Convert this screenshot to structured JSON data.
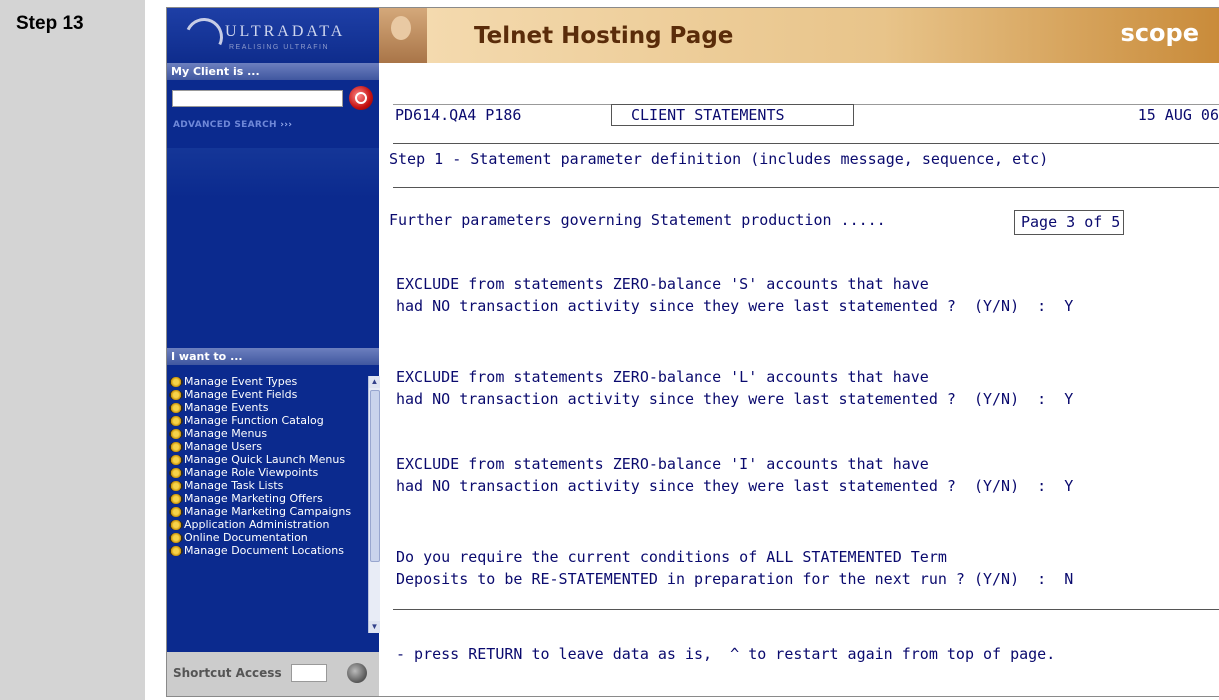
{
  "step_label": "Step 13",
  "sidebar": {
    "logo_text": "ULTRADATA",
    "logo_tagline": "REALISING ULTRAFIN",
    "client_section_title": "My Client is ...",
    "client_input_value": "",
    "advanced_search": "ADVANCED SEARCH",
    "iwant_section_title": "I want to ...",
    "menu_items": [
      "Manage Event Types",
      "Manage Event Fields",
      "Manage Events",
      "Manage Function Catalog",
      "Manage Menus",
      "Manage Users",
      "Manage Quick Launch Menus",
      "Manage Role Viewpoints",
      "Manage Task Lists",
      "Manage Marketing Offers",
      "Manage Marketing Campaigns",
      "Application Administration",
      "Online Documentation",
      "Manage Document Locations"
    ],
    "shortcut_label": "Shortcut Access",
    "shortcut_value": ""
  },
  "header": {
    "title": "Telnet Hosting Page",
    "brand": "scope"
  },
  "terminal": {
    "program_id": "PD614.QA4 P186",
    "screen_title": "CLIENT STATEMENTS",
    "date": "15 AUG 06",
    "step_line": "Step 1 - Statement parameter definition (includes message, sequence, etc)",
    "further_line": "Further parameters governing Statement production .....",
    "page_indicator": "Page 3 of 5",
    "q1_line1": "EXCLUDE from statements ZERO-balance 'S' accounts that have",
    "q1_line2": "had NO transaction activity since they were last statemented ?  (Y/N)  :  Y",
    "q2_line1": "EXCLUDE from statements ZERO-balance 'L' accounts that have",
    "q2_line2": "had NO transaction activity since they were last statemented ?  (Y/N)  :  Y",
    "q3_line1": "EXCLUDE from statements ZERO-balance 'I' accounts that have",
    "q3_line2": "had NO transaction activity since they were last statemented ?  (Y/N)  :  Y",
    "q4_line1": "Do you require the current conditions of ALL STATEMENTED Term",
    "q4_line2": "Deposits to be RE-STATEMENTED in preparation for the next run ? (Y/N)  :  N",
    "footer": "- press RETURN to leave data as is,  ^ to restart again from top of page."
  }
}
